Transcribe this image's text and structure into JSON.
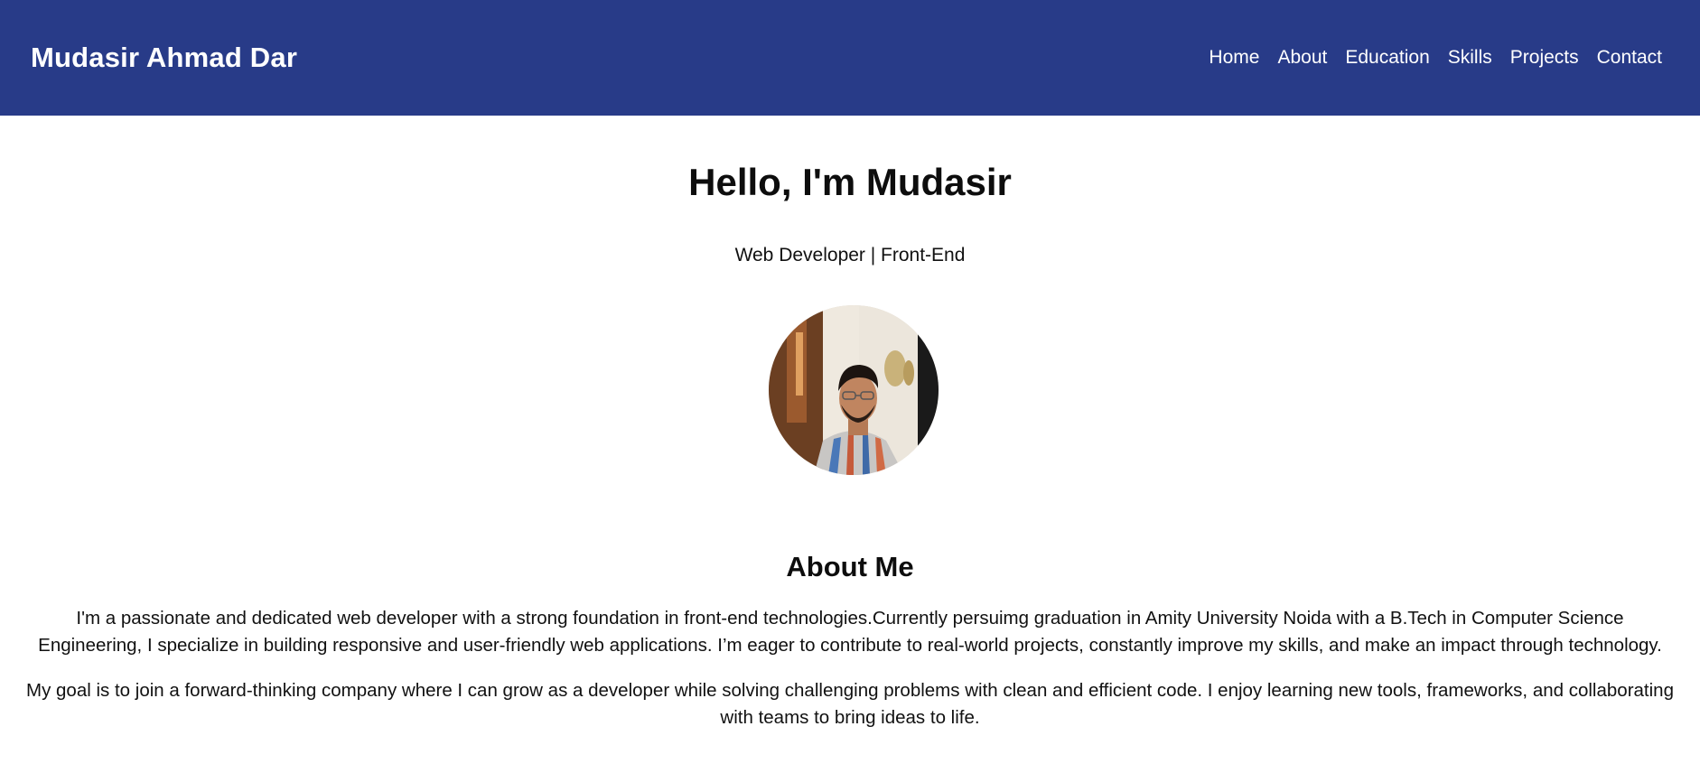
{
  "navbar": {
    "brand": "Mudasir Ahmad Dar",
    "links": [
      "Home",
      "About",
      "Education",
      "Skills",
      "Projects",
      "Contact"
    ],
    "background": "#283b88"
  },
  "hero": {
    "title": "Hello, I'm Mudasir",
    "subtitle": "Web Developer | Front-End",
    "avatar_icon": "profile-photo"
  },
  "about": {
    "title": "About Me",
    "paragraphs": [
      "I'm a passionate and dedicated web developer with a strong foundation in front-end technologies.Currently persuimg graduation in Amity University Noida with a B.Tech in Computer Science Engineering, I specialize in building responsive and user-friendly web applications. I’m eager to contribute to real-world projects, constantly improve my skills, and make an impact through technology.",
      "My goal is to join a forward-thinking company where I can grow as a developer while solving challenging problems with clean and efficient code. I enjoy learning new tools, frameworks, and collaborating with teams to bring ideas to life."
    ]
  }
}
